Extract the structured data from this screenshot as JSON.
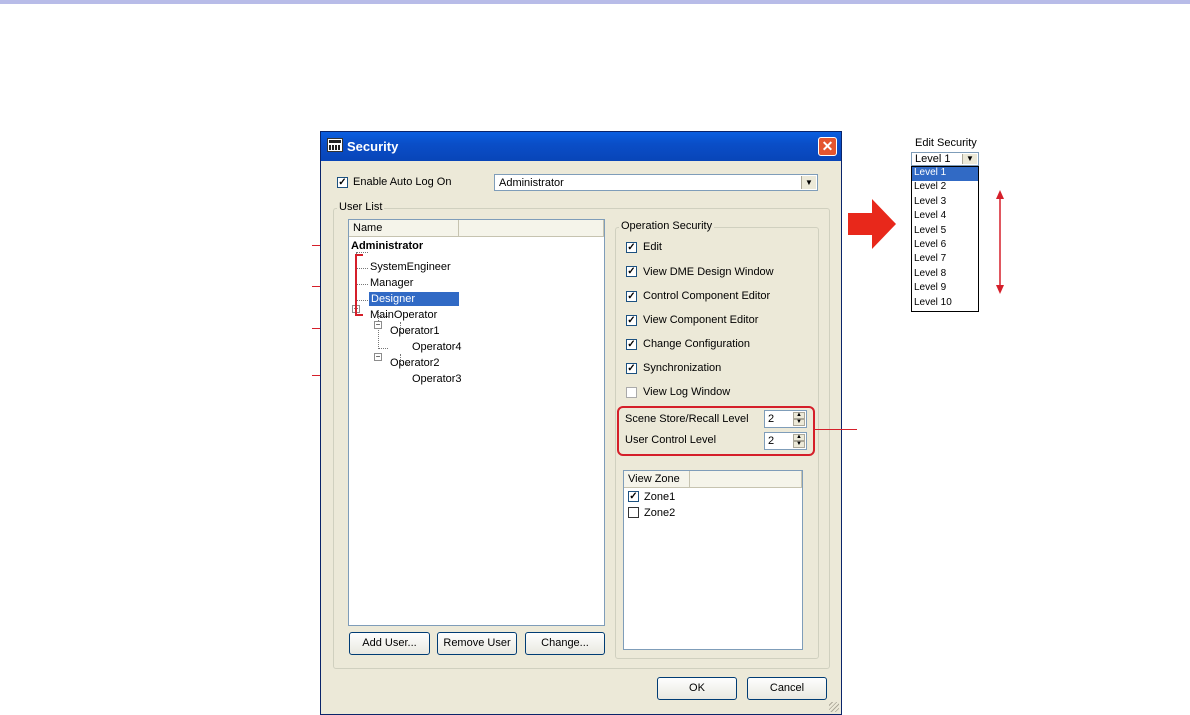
{
  "dialog": {
    "title": "Security",
    "close_label": "✕",
    "auto_logon": {
      "label": "Enable Auto Log On",
      "checked": true,
      "value": "Administrator"
    },
    "user_list": {
      "group_label": "User List",
      "column_header": "Name",
      "users": [
        "Administrator",
        "SystemEngineer",
        "Manager",
        "Designer",
        "MainOperator",
        "Operator1",
        "Operator4",
        "Operator2",
        "Operator3"
      ],
      "selected": "Designer"
    },
    "operation_security": {
      "group_label": "Operation Security",
      "items": [
        {
          "label": "Edit",
          "checked": true
        },
        {
          "label": "View DME Design Window",
          "checked": true
        },
        {
          "label": "Control Component Editor",
          "checked": true
        },
        {
          "label": "View Component Editor",
          "checked": true
        },
        {
          "label": "Change Configuration",
          "checked": true
        },
        {
          "label": "Synchronization",
          "checked": true
        },
        {
          "label": "View Log Window",
          "checked": false
        }
      ],
      "scene_store_label": "Scene Store/Recall Level",
      "scene_store_value": "2",
      "user_control_label": "User Control Level",
      "user_control_value": "2"
    },
    "view_zone": {
      "header": "View Zone",
      "zones": [
        {
          "label": "Zone1",
          "checked": true
        },
        {
          "label": "Zone2",
          "checked": false
        }
      ]
    },
    "buttons": {
      "add_user": "Add User...",
      "remove_user": "Remove User",
      "change": "Change...",
      "ok": "OK",
      "cancel": "Cancel"
    }
  },
  "edit_security": {
    "title": "Edit Security",
    "value": "Level 1",
    "options": [
      "Level 1",
      "Level 2",
      "Level 3",
      "Level 4",
      "Level 5",
      "Level 6",
      "Level 7",
      "Level 8",
      "Level 9",
      "Level 10"
    ],
    "selected": "Level 1"
  },
  "colors": {
    "accent_red": "#d51f2a",
    "selection_blue": "#316ac5",
    "title_blue": "#0a4ec8"
  }
}
